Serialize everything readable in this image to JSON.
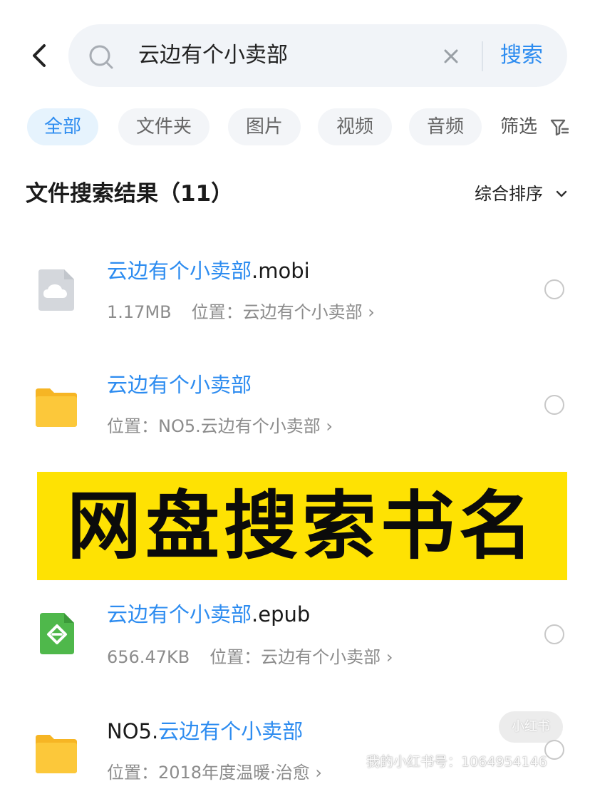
{
  "search": {
    "query": "云边有个小卖部",
    "button_label": "搜索"
  },
  "chips": [
    {
      "label": "全部",
      "active": true
    },
    {
      "label": "文件夹",
      "active": false
    },
    {
      "label": "图片",
      "active": false
    },
    {
      "label": "视频",
      "active": false
    },
    {
      "label": "音频",
      "active": false
    }
  ],
  "filter_label": "筛选",
  "results": {
    "title": "文件搜索结果（11）",
    "sort_label": "综合排序"
  },
  "files": [
    {
      "icon": "cloud-file-icon",
      "name_highlight": "云边有个小卖部",
      "name_suffix": ".mobi",
      "size": "1.17MB",
      "location": "位置：云边有个小卖部"
    },
    {
      "icon": "folder-icon",
      "name_highlight": "云边有个小卖部",
      "name_suffix": "",
      "size": "",
      "location": "位置：NO5.云边有个小卖部"
    },
    {
      "icon": "epub-icon",
      "name_highlight": "云边有个小卖部",
      "name_suffix": ".epub",
      "size": "656.47KB",
      "location": "位置：云边有个小卖部"
    },
    {
      "icon": "folder-icon",
      "name_prefix": "NO5.",
      "name_highlight": "云边有个小卖部",
      "size": "",
      "location": "位置：2018年度温暖·治愈"
    }
  ],
  "banner": {
    "text": "网盘搜索书名"
  },
  "watermark": {
    "logo": "小红书",
    "text": "我的小红书号：1064954146"
  },
  "colors": {
    "accent": "#2d8cf0",
    "banner_bg": "#fee203",
    "search_bg": "#f1f4f8",
    "folder": "#fcc83a"
  }
}
